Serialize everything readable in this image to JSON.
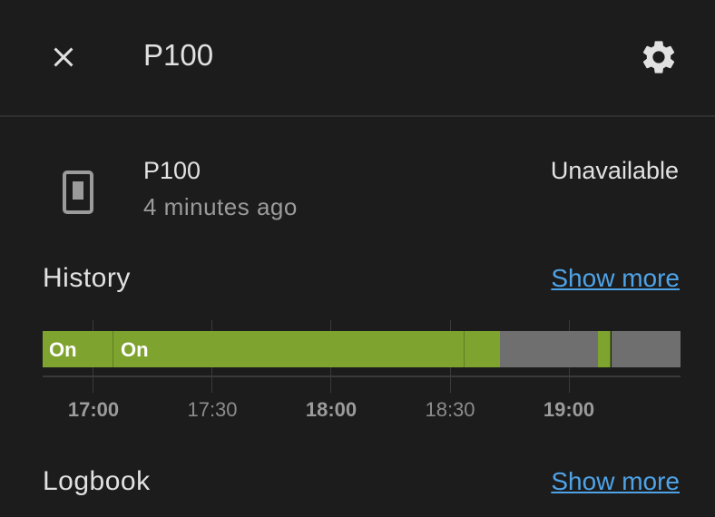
{
  "header": {
    "title": "P100",
    "close_icon": "close-icon",
    "settings_icon": "gear-icon"
  },
  "entity": {
    "name": "P100",
    "last_changed": "4 minutes ago",
    "state": "Unavailable",
    "icon": "light-switch-icon"
  },
  "history": {
    "title": "History",
    "show_more": "Show more",
    "segments": [
      {
        "label": "On",
        "state": "on",
        "color": "#7ea32e"
      },
      {
        "label": "On",
        "state": "on",
        "color": "#7ea32e"
      },
      {
        "label": "",
        "state": "on",
        "color": "#7ea32e"
      },
      {
        "label": "",
        "state": "unavailable",
        "color": "#6f6f6f"
      },
      {
        "label": "",
        "state": "on",
        "color": "#7ea32e"
      },
      {
        "label": "",
        "state": "unavailable",
        "color": "#6f6f6f"
      }
    ],
    "ticks": [
      {
        "label": "17:00",
        "major": true
      },
      {
        "label": "17:30",
        "major": false
      },
      {
        "label": "18:00",
        "major": true
      },
      {
        "label": "18:30",
        "major": false
      },
      {
        "label": "19:00",
        "major": true
      }
    ]
  },
  "logbook": {
    "title": "Logbook",
    "show_more": "Show more"
  },
  "colors": {
    "on": "#7ea32e",
    "unavailable": "#6f6f6f",
    "link": "#4fa3e7",
    "background": "#1c1c1c"
  }
}
